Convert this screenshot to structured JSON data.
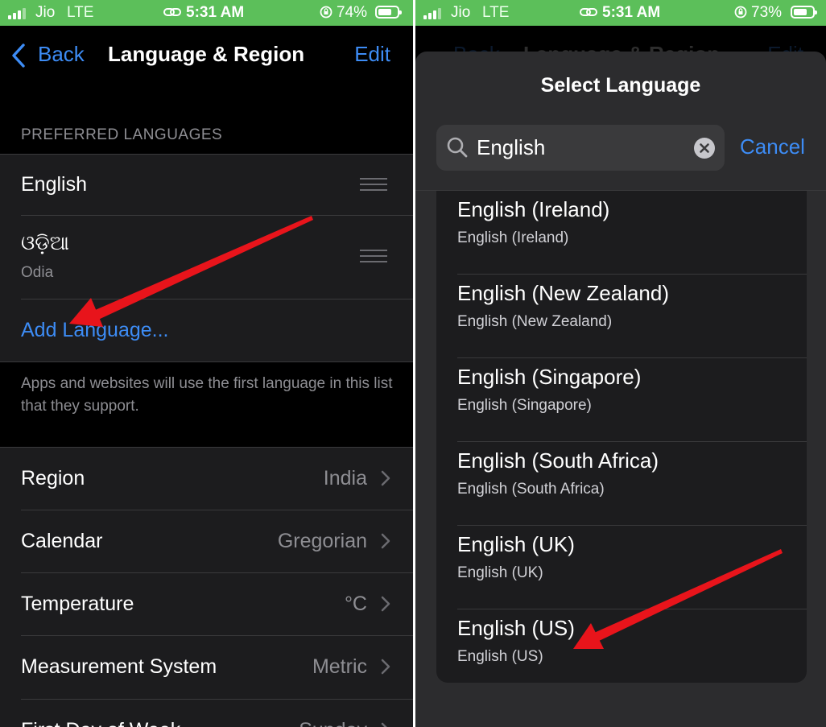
{
  "left": {
    "status": {
      "carrier": "Jio",
      "network": "LTE",
      "time": "5:31 AM",
      "battery": "74%",
      "battery_level": 0.74
    },
    "nav": {
      "back_label": "Back",
      "title": "Language & Region",
      "edit_label": "Edit"
    },
    "preferred_header": "PREFERRED LANGUAGES",
    "languages": [
      {
        "name": "English",
        "subtitle": ""
      },
      {
        "name": "ଓଡ଼ିଆ",
        "subtitle": "Odia"
      }
    ],
    "add_language": "Add Language...",
    "footnote": "Apps and websites will use the first language in this list that they support.",
    "settings": [
      {
        "label": "Region",
        "value": "India"
      },
      {
        "label": "Calendar",
        "value": "Gregorian"
      },
      {
        "label": "Temperature",
        "value": "°C"
      },
      {
        "label": "Measurement System",
        "value": "Metric"
      },
      {
        "label": "First Day of Week",
        "value": "Sunday"
      }
    ]
  },
  "right": {
    "status": {
      "carrier": "Jio",
      "network": "LTE",
      "time": "5:31 AM",
      "battery": "73%",
      "battery_level": 0.73
    },
    "behind": {
      "back_label": "Back",
      "title": "Language & Region",
      "edit_label": "Edit"
    },
    "sheet_title": "Select Language",
    "search": {
      "value": "English",
      "placeholder": "Search"
    },
    "cancel_label": "Cancel",
    "results": [
      {
        "name": "English (Ireland)",
        "native": "English (Ireland)"
      },
      {
        "name": "English (New Zealand)",
        "native": "English (New Zealand)"
      },
      {
        "name": "English (Singapore)",
        "native": "English (Singapore)"
      },
      {
        "name": "English (South Africa)",
        "native": "English (South Africa)"
      },
      {
        "name": "English (UK)",
        "native": "English (UK)"
      },
      {
        "name": "English (US)",
        "native": "English (US)"
      }
    ]
  },
  "colors": {
    "status_bar": "#5cbf5a",
    "accent_blue": "#3d8cf5",
    "annotation_red": "#e8141b"
  },
  "icons": [
    "signal-icon",
    "link-icon",
    "orientation-lock-icon",
    "battery-icon",
    "chevron-left-icon",
    "reorder-grip-icon",
    "chevron-right-icon",
    "search-icon",
    "clear-icon",
    "annotation-arrow-icon"
  ]
}
